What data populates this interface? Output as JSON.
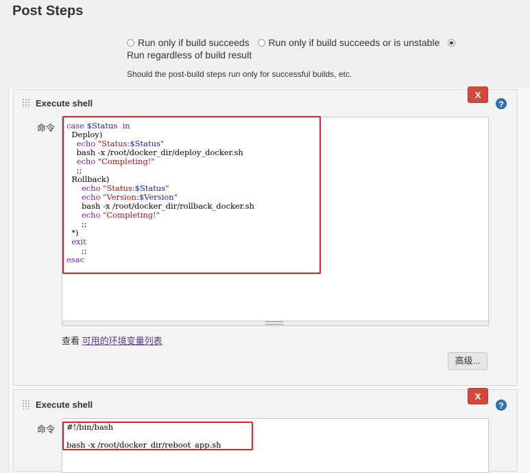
{
  "section_title": "Post Steps",
  "post_step_condition": {
    "options": [
      {
        "label": "Run only if build succeeds",
        "checked": false
      },
      {
        "label": "Run only if build succeeds or is unstable",
        "checked": false
      },
      {
        "label": "Run regardless of build result",
        "checked": true
      }
    ],
    "help_text": "Should the post-build steps run only for successful builds, etc."
  },
  "steps": [
    {
      "title": "Execute shell",
      "delete_label": "X",
      "help_label": "?",
      "command_label": "命令",
      "see_prefix": "查看",
      "env_link": "可用的环境变量列表",
      "advanced_label": "高级...",
      "code": [
        "case $Status  in",
        "  Deploy)",
        "    echo \"Status:$Status\"",
        "    bash -x /root/docker_dir/deploy_docker.sh",
        "    echo \"Completing!\"",
        "    ;;",
        "  Rollback)",
        "      echo \"Status:$Status\"",
        "      echo \"Version:$Version\"",
        "      bash -x /root/docker_dir/rollback_docker.sh",
        "      echo \"Completing!\"",
        "      ;;",
        "  *)",
        "  exit",
        "      ;;",
        "esac"
      ]
    },
    {
      "title": "Execute shell",
      "delete_label": "X",
      "help_label": "?",
      "command_label": "命令",
      "code": [
        "#!/bin/bash",
        "",
        "bash -x /root/docker_dir/reboot_app.sh"
      ]
    }
  ],
  "colors": {
    "delete_red": "#d24939",
    "help_blue": "#2f73b8",
    "highlight_red": "#e02020",
    "keyword_purple": "#7a1c9e",
    "string_red": "#b01010",
    "variable_blue": "#1b1b9e"
  },
  "icons": [
    "drag-handle-icon",
    "close-icon",
    "help-icon"
  ]
}
